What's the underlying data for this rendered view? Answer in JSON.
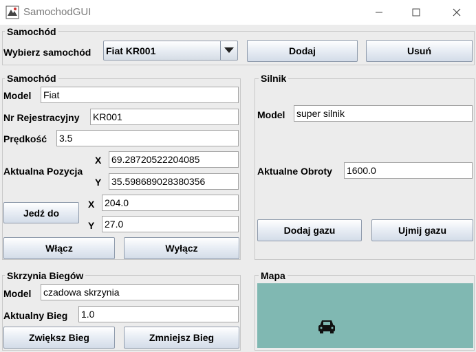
{
  "window": {
    "title": "SamochodGUI"
  },
  "top_panel": {
    "legend": "Samochód",
    "select_label": "Wybierz samochód",
    "selected_car": "Fiat KR001",
    "add_button": "Dodaj",
    "remove_button": "Usuń"
  },
  "car_panel": {
    "legend": "Samochód",
    "model_label": "Model",
    "model_value": "Fiat",
    "registration_label": "Nr Rejestracyjny",
    "registration_value": "KR001",
    "speed_label": "Prędkość",
    "speed_value": "3.5",
    "position_label": "Aktualna Pozycja",
    "pos_x_label": "X",
    "pos_x_value": "69.28720522204085",
    "pos_y_label": "Y",
    "pos_y_value": "35.598689028380356",
    "drive_button": "Jedź do",
    "target_x_label": "X",
    "target_x_value": "204.0",
    "target_y_label": "Y",
    "target_y_value": "27.0",
    "on_button": "Włącz",
    "off_button": "Wyłącz"
  },
  "engine_panel": {
    "legend": "Silnik",
    "model_label": "Model",
    "model_value": "super silnik",
    "rpm_label": "Aktualne Obroty",
    "rpm_value": "1600.0",
    "throttle_up_button": "Dodaj gazu",
    "throttle_down_button": "Ujmij gazu"
  },
  "gearbox_panel": {
    "legend": "Skrzynia Biegów",
    "model_label": "Model",
    "model_value": "czadowa skrzynia",
    "gear_label": "Aktualny Bieg",
    "gear_value": "1.0",
    "gear_up_button": "Zwiększ Bieg",
    "gear_down_button": "Zmniejsz Bieg"
  },
  "map_panel": {
    "legend": "Mapa",
    "background_color": "#80b8b2",
    "car_icon": "car-icon"
  }
}
